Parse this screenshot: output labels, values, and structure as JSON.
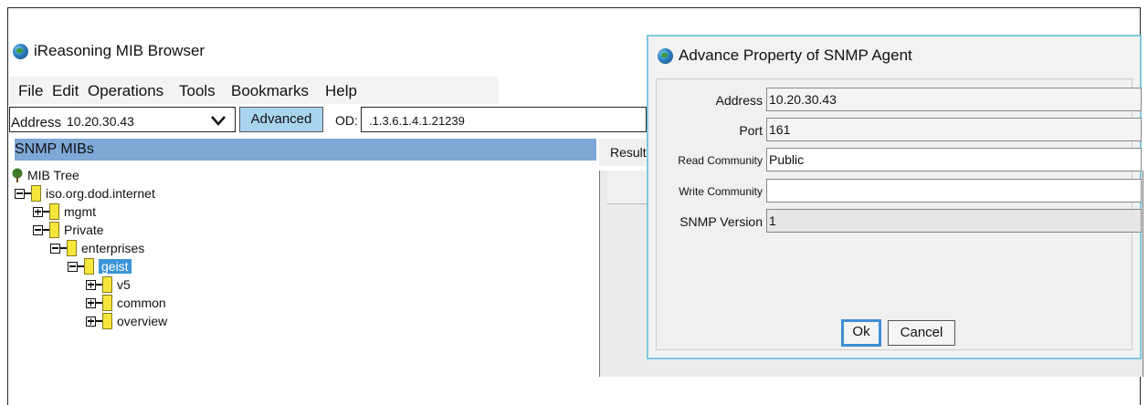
{
  "app": {
    "title": "iReasoning MIB Browser"
  },
  "menu": [
    "File",
    "Edit",
    "Operations",
    "Tools",
    "Bookmarks",
    "Help"
  ],
  "toolbar": {
    "address_label": "Address",
    "address_value": "10.20.30.43",
    "advanced_label": "Advanced",
    "oid_label": "OD:",
    "oid_value": ".1.3.6.1.4.1.21239"
  },
  "mibs": {
    "header": "SNMP MIBs",
    "tree": [
      {
        "label": "MIB Tree",
        "icon": "tree-icon",
        "state": "root"
      },
      {
        "label": "iso.org.dod.internet",
        "state": "expanded"
      },
      {
        "label": "mgmt",
        "state": "collapsed"
      },
      {
        "label": "Private",
        "state": "expanded"
      },
      {
        "label": "enterprises",
        "state": "expanded"
      },
      {
        "label": "geist",
        "state": "expanded",
        "selected": true
      },
      {
        "label": "v5",
        "state": "collapsed"
      },
      {
        "label": "common",
        "state": "collapsed"
      },
      {
        "label": "overview",
        "state": "collapsed"
      }
    ]
  },
  "result": {
    "tab_label": "Result"
  },
  "dialog": {
    "title": "Advance Property of SNMP Agent",
    "fields": [
      {
        "label": "Address",
        "value": "10.20.30.43"
      },
      {
        "label": "Port",
        "value": "161"
      },
      {
        "label": "Read Community",
        "value": "Public"
      },
      {
        "label": "Write Community",
        "value": ""
      },
      {
        "label": "SNMP Version",
        "value": "1"
      }
    ],
    "ok_label": "Ok",
    "cancel_label": "Cancel"
  },
  "colors": {
    "accent": "#3a95d6",
    "header": "#7ea8d6",
    "advanced_button": "#a9d4ee",
    "dialog_border": "#7ec8df",
    "folder": "#f6e63c"
  }
}
